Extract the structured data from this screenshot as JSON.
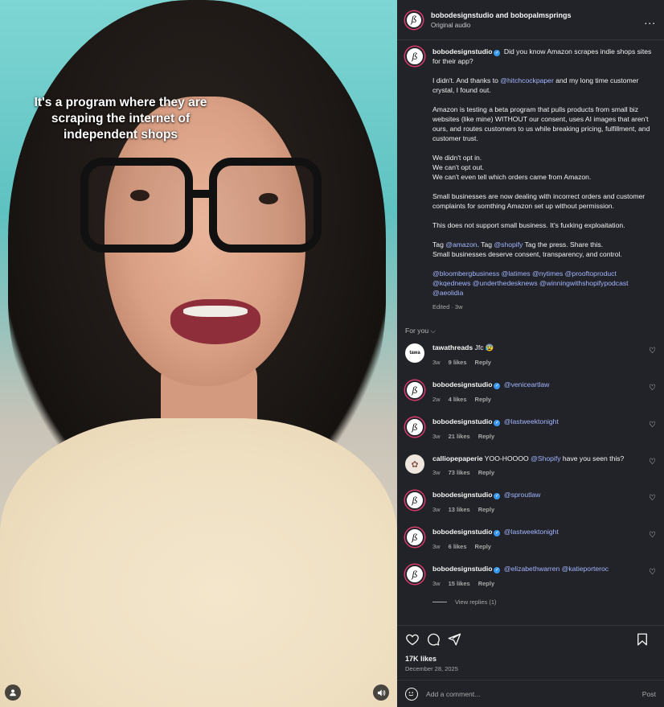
{
  "video": {
    "caption_text": "It's a program where they are scraping the internet of independent shops"
  },
  "header": {
    "title": "bobodesignstudio and bobopalmsprings",
    "subtitle": "Original audio",
    "more": "..."
  },
  "post": {
    "username": "bobodesignstudio",
    "line1": " Did you know Amazon scrapes indie shops sites for their app?",
    "p2_a": "I didn't. And thanks to ",
    "p2_mention": "@hitchcockpaper",
    "p2_b": " and my long time customer crystal, I found out.",
    "p3": "Amazon is testing a beta program that pulls products from small biz websites (like mine) WITHOUT our consent, uses AI images that aren't ours, and routes customers to us while breaking pricing, fulfillment, and customer trust.",
    "p4_l1": "We didn't opt in.",
    "p4_l2": "We can't opt out.",
    "p4_l3": "We can't even tell which orders came from Amazon.",
    "p5": "Small businesses are now dealing with incorrect orders and customer complaints for somthing Amazon set up without permission.",
    "p6": "This does not support small business. It's fuxking exploaitation.",
    "p7_a": "Tag ",
    "p7_m1": "@amazon",
    "p7_b": ". Tag ",
    "p7_m2": "@shopify",
    "p7_c": " Tag the press. Share this.",
    "p7_l2": "Small businesses deserve consent, transparency, and control.",
    "tags": "@bloombergbusiness @latimes @nytimes @prooftoproduct @kqednews @underthedesknews @winningwithshopifypodcast @aeolidia",
    "edited": "Edited · 3w"
  },
  "comments_header": "For you",
  "comments": [
    {
      "user": "tawathreads",
      "text": " Jfc 😰",
      "age": "3w",
      "likes": "9 likes",
      "reply": "Reply"
    },
    {
      "user": "bobodesignstudio",
      "text": "@veniceartlaw",
      "age": "2w",
      "likes": "4 likes",
      "reply": "Reply"
    },
    {
      "user": "bobodesignstudio",
      "text": "@lastweektonight",
      "age": "3w",
      "likes": "21 likes",
      "reply": "Reply"
    },
    {
      "user": "calliopepaperie",
      "text_a": " YOO-HOOOO ",
      "mention": "@Shopify",
      "text_b": " have you seen this?",
      "age": "3w",
      "likes": "73 likes",
      "reply": "Reply"
    },
    {
      "user": "bobodesignstudio",
      "text": "@sproutlaw",
      "age": "3w",
      "likes": "13 likes",
      "reply": "Reply"
    },
    {
      "user": "bobodesignstudio",
      "text": "@lastweektonight",
      "age": "3w",
      "likes": "6 likes",
      "reply": "Reply"
    },
    {
      "user": "bobodesignstudio",
      "text": "@elizabethwarren @katieporteroc",
      "age": "3w",
      "likes": "15 likes",
      "reply": "Reply"
    }
  ],
  "view_replies": "View replies (1)",
  "footer": {
    "likes": "17K likes",
    "date": "December 28, 2025",
    "comment_placeholder": "Add a comment...",
    "post_label": "Post"
  },
  "icons": {
    "heart": "heart-icon",
    "comment": "comment-icon",
    "share": "share-icon",
    "save": "bookmark-icon",
    "emoji": "emoji-icon",
    "verified": "verified-badge-icon"
  },
  "colors": {
    "panel_bg": "#212328",
    "mention": "#a4b5ff",
    "verified": "#3897f0",
    "story_ring": "#d93b6b"
  }
}
